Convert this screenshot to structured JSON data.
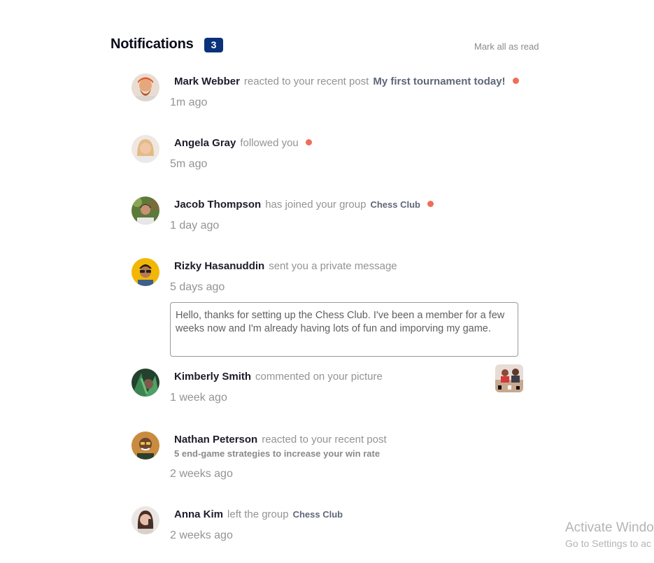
{
  "header": {
    "title": "Notifications",
    "unread_count": "3",
    "mark_all_label": "Mark all as read"
  },
  "notifications": [
    {
      "name": "Mark Webber",
      "action": "reacted to your recent post",
      "target": "My first tournament today!",
      "unread": true,
      "time": "1m ago",
      "avatar": "avatar-mark-webber"
    },
    {
      "name": "Angela Gray",
      "action": "followed you",
      "unread": true,
      "time": "5m ago",
      "avatar": "avatar-angela-gray"
    },
    {
      "name": "Jacob Thompson",
      "action": "has joined your group",
      "target": "Chess Club",
      "unread": true,
      "time": "1 day ago",
      "avatar": "avatar-jacob-thompson"
    },
    {
      "name": "Rizky Hasanuddin",
      "action": "sent you a private message",
      "time": "5 days ago",
      "message": "Hello, thanks for setting up the Chess Club. I've been a member for a few weeks now and I'm already having lots of fun and imporving my game.",
      "avatar": "avatar-rizky-hasanuddin"
    },
    {
      "name": "Kimberly Smith",
      "action": "commented on your picture",
      "time": "1 week ago",
      "thumbnail": "chess-picture-thumbnail",
      "avatar": "avatar-kimberly-smith"
    },
    {
      "name": "Nathan Peterson",
      "action": "reacted to your recent post",
      "target": "5 end-game strategies to increase your win rate",
      "time": "2 weeks ago",
      "avatar": "avatar-nathan-peterson"
    },
    {
      "name": "Anna Kim",
      "action": "left the group",
      "target": "Chess Club",
      "time": "2 weeks ago",
      "avatar": "avatar-anna-kim"
    }
  ],
  "watermark": {
    "line1": "Activate Windo",
    "line2": "Go to Settings to ac"
  },
  "colors": {
    "badge": "#0a327b",
    "unread_dot": "#f06d5a",
    "muted_text": "#939393"
  }
}
